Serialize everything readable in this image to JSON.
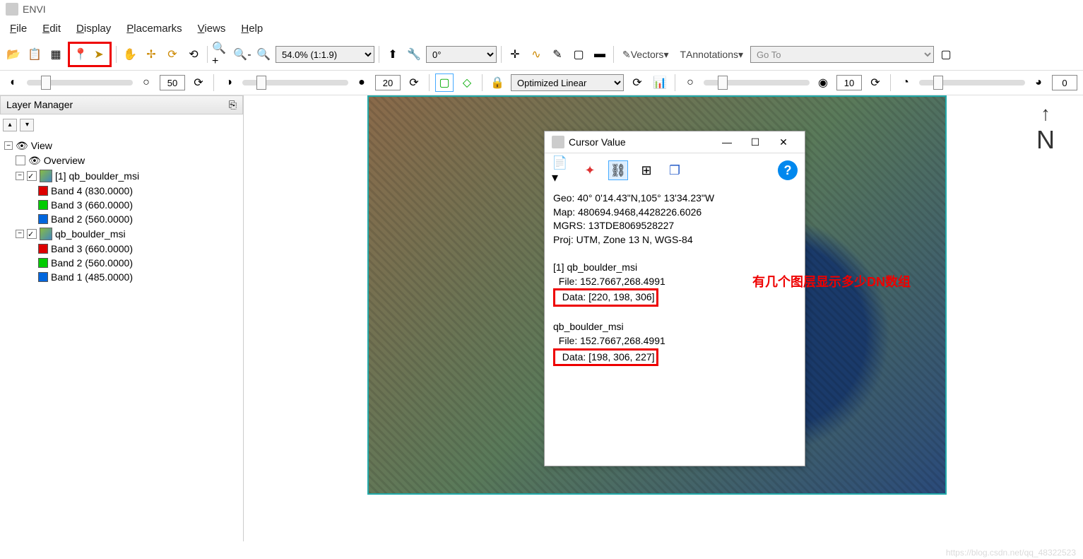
{
  "app": {
    "title": "ENVI"
  },
  "menu": {
    "file": "File",
    "edit": "Edit",
    "display": "Display",
    "placemarks": "Placemarks",
    "views": "Views",
    "help": "Help"
  },
  "toolbar": {
    "zoom": "54.0% (1:1.9)",
    "rotation": "0°",
    "vectors": "Vectors",
    "annotations": "Annotations",
    "goto": "Go To"
  },
  "toolbar2": {
    "val1": "50",
    "val2": "20",
    "stretch": "Optimized Linear",
    "val3": "10",
    "val4": "0"
  },
  "layer_panel": {
    "title": "Layer Manager",
    "view": "View",
    "overview": "Overview",
    "layer1": "[1] qb_boulder_msi",
    "l1b4": "Band 4 (830.0000)",
    "l1b3": "Band 3 (660.0000)",
    "l1b2": "Band 2 (560.0000)",
    "layer2": "qb_boulder_msi",
    "l2b3": "Band 3 (660.0000)",
    "l2b2": "Band 2 (560.0000)",
    "l2b1": "Band 1 (485.0000)"
  },
  "compass": "N",
  "cursor_win": {
    "title": "Cursor Value",
    "geo": "Geo: 40° 0'14.43\"N,105° 13'34.23\"W",
    "map": "Map: 480694.9468,4428226.6026",
    "mgrs": "MGRS: 13TDE8069528227",
    "proj": "Proj: UTM, Zone 13 N, WGS-84",
    "ds1_name": "[1] qb_boulder_msi",
    "ds1_file": "  File: 152.7667,268.4991",
    "ds1_data": "  Data: [220, 198, 306]",
    "ds2_name": "qb_boulder_msi",
    "ds2_file": "  File: 152.7667,268.4991",
    "ds2_data": "  Data: [198, 306, 227]"
  },
  "annotation": "有几个图层显示多少DN数组",
  "watermark": "https://blog.csdn.net/qq_48322523"
}
